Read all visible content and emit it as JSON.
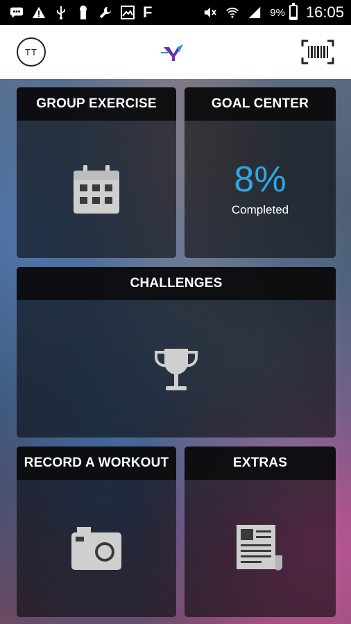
{
  "status_bar": {
    "left_icons": [
      "message-icon",
      "warning-icon",
      "usb-icon",
      "keyhole-icon",
      "wrench-icon",
      "image-icon",
      "f-icon"
    ],
    "f_label": "F",
    "battery_pct": "9%",
    "time": "16:05"
  },
  "header": {
    "avatar_initials": "TT",
    "logo": "ymca-logo",
    "barcode_icon": "barcode-icon",
    "brand_color": "#6b2fb3"
  },
  "tiles": {
    "group_exercise": {
      "title": "GROUP EXERCISE",
      "icon": "calendar-icon"
    },
    "goal_center": {
      "title": "GOAL CENTER",
      "percent": "8%",
      "subtitle": "Completed",
      "accent": "#2ea6e6"
    },
    "challenges": {
      "title": "CHALLENGES",
      "icon": "trophy-icon"
    },
    "record_workout": {
      "title": "RECORD A WORKOUT",
      "icon": "camera-icon"
    },
    "extras": {
      "title": "EXTRAS",
      "icon": "newspaper-icon"
    }
  }
}
